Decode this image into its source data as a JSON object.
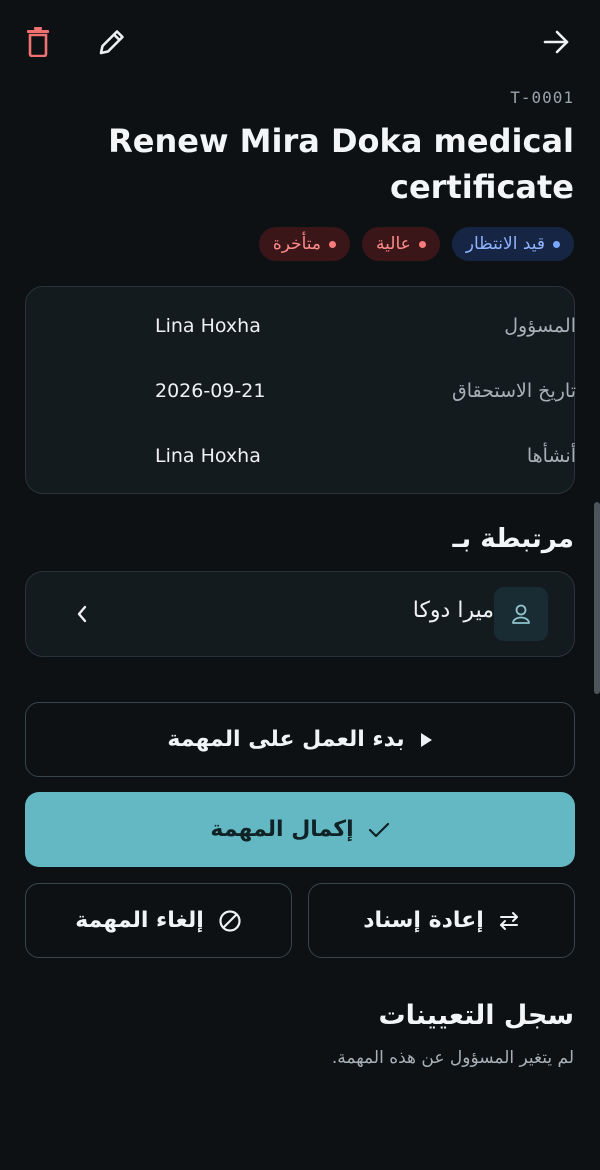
{
  "header": {
    "delete_icon": "trash-icon",
    "edit_icon": "pencil-icon",
    "back_icon": "arrow-right-icon"
  },
  "task": {
    "id": "T-0001",
    "title": "Renew Mira Doka medical certificate"
  },
  "chips": {
    "status": "قيد الانتظار",
    "priority": "عالية",
    "overdue": "متأخرة"
  },
  "info": {
    "assignee_label": "المسؤول",
    "assignee_value": "Lina Hoxha",
    "due_label": "تاريخ الاستحقاق",
    "due_value": "2026-09-21",
    "created_label": "أنشأها",
    "created_value": "Lina Hoxha"
  },
  "linked": {
    "title": "مرتبطة بـ",
    "name": "ميرا دوكا"
  },
  "actions": {
    "start": "بدء العمل على المهمة",
    "complete": "إكمال المهمة",
    "reassign": "إعادة إسناد",
    "cancel": "إلغاء المهمة"
  },
  "history": {
    "title": "سجل التعيينات",
    "empty": "لم يتغير المسؤول عن هذه المهمة."
  },
  "colors": {
    "background": "#0d1114",
    "accent": "#63b8c4",
    "danger": "#ff7b7b",
    "status": "#7aa6ff"
  }
}
